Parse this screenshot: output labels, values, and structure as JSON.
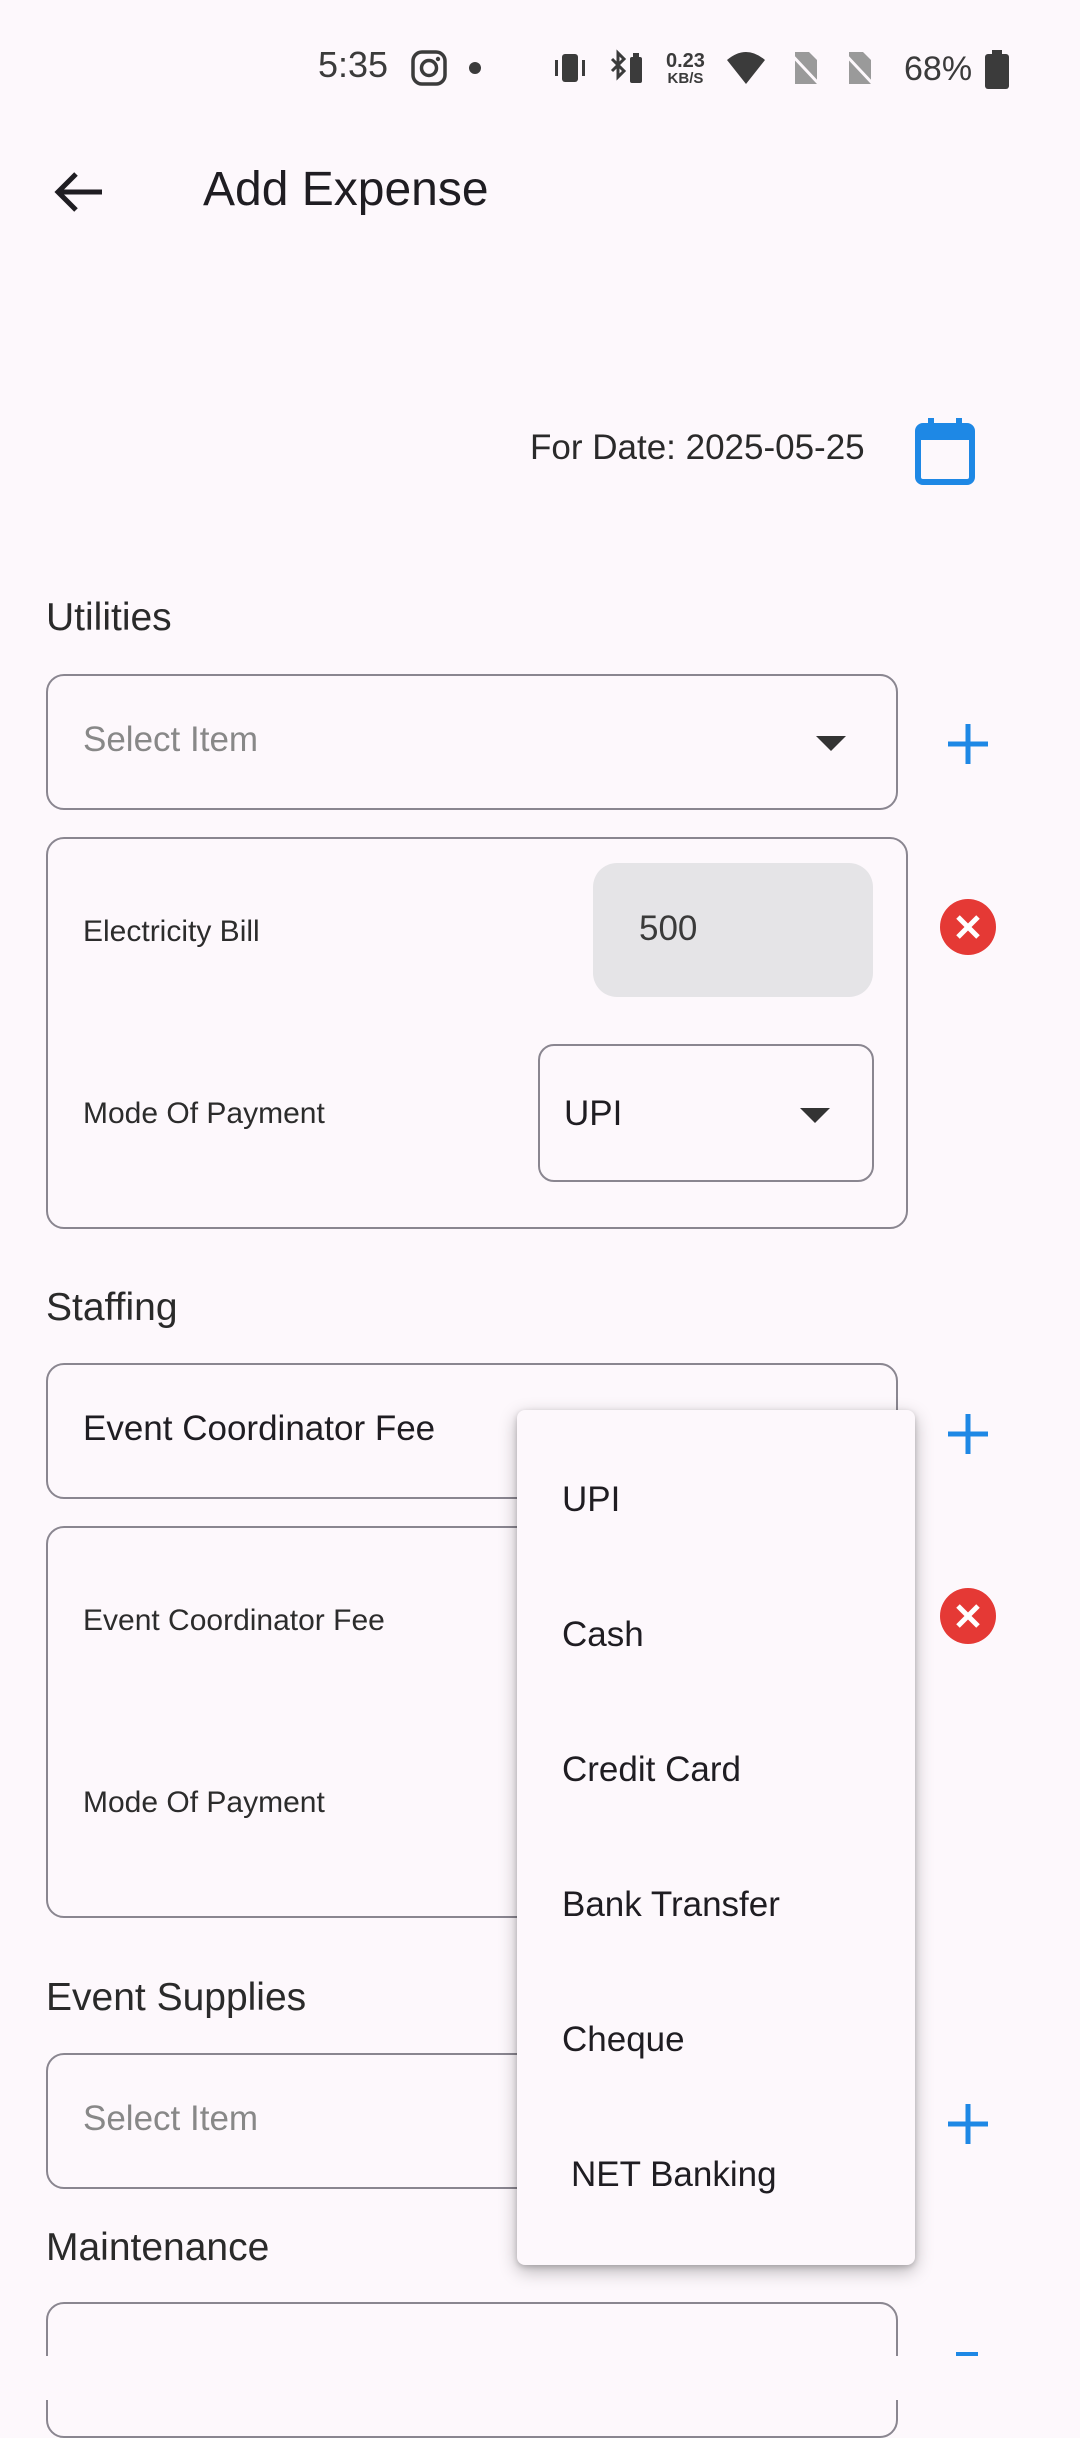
{
  "status_bar": {
    "time": "5:35",
    "network_speed": "0.23",
    "network_unit": "KB/S",
    "battery": "68%"
  },
  "app_bar": {
    "title": "Add Expense"
  },
  "date": {
    "label": "For Date: 2025-05-25"
  },
  "sections": [
    {
      "title": "Utilities",
      "select_placeholder": "Select Item",
      "item": {
        "name": "Electricity Bill",
        "amount": "500",
        "mode_label": "Mode Of Payment",
        "mode_value": "UPI"
      }
    },
    {
      "title": "Staffing",
      "select_value": "Event Coordinator Fee",
      "item": {
        "name": "Event Coordinator Fee",
        "mode_label": "Mode Of Payment"
      }
    },
    {
      "title": "Event Supplies",
      "select_placeholder": "Select Item"
    },
    {
      "title": "Maintenance"
    }
  ],
  "payment_menu": {
    "options": [
      "UPI",
      "Cash",
      "Credit Card",
      "Bank Transfer",
      "Cheque",
      "NET Banking"
    ]
  },
  "colors": {
    "accent": "#1e88e5",
    "remove": "#e53935",
    "background": "#fdf8fc"
  }
}
